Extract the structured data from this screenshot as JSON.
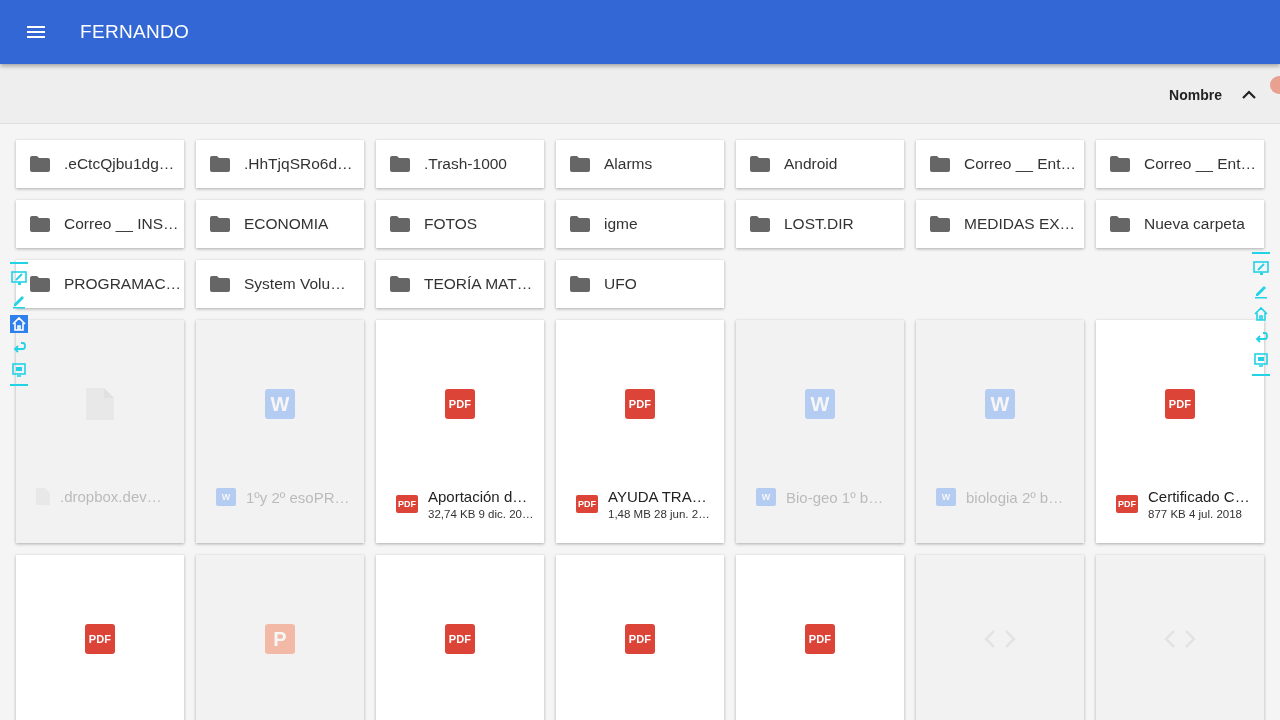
{
  "app_bar": {
    "title": "FERNANDO"
  },
  "sort_bar": {
    "label": "Nombre",
    "ascending": true
  },
  "folders": [
    {
      "name": ".eCtcQjbu1dg…"
    },
    {
      "name": ".HhTjqSRo6d…"
    },
    {
      "name": ".Trash-1000"
    },
    {
      "name": "Alarms"
    },
    {
      "name": "Android"
    },
    {
      "name": "Correo __ Ent…"
    },
    {
      "name": "Correo __ Ent…"
    },
    {
      "name": "Correo __ INS…"
    },
    {
      "name": "ECONOMIA"
    },
    {
      "name": "FOTOS"
    },
    {
      "name": "igme"
    },
    {
      "name": "LOST.DIR"
    },
    {
      "name": "MEDIDAS EX…"
    },
    {
      "name": "Nueva carpeta"
    },
    {
      "name": "PROGRAMAC…"
    },
    {
      "name": "System Volu…"
    },
    {
      "name": "TEORÍA MAT…"
    },
    {
      "name": "UFO"
    }
  ],
  "files": [
    {
      "kind": "generic",
      "dimmed": true,
      "name": ".dropbox.dev…"
    },
    {
      "kind": "word",
      "dimmed": true,
      "badge": "W",
      "small_badge": "W",
      "name": "1ºy 2º esoPR…"
    },
    {
      "kind": "pdf",
      "dimmed": false,
      "badge": "PDF",
      "small_badge": "PDF",
      "name": "Aportación d…",
      "details": "32,74 KB 9 dic. 20…"
    },
    {
      "kind": "pdf",
      "dimmed": false,
      "badge": "PDF",
      "small_badge": "PDF",
      "name": "AYUDA TRA…",
      "details": "1,48 MB 28 jun. 2…"
    },
    {
      "kind": "word",
      "dimmed": true,
      "badge": "W",
      "small_badge": "W",
      "name": "Bio-geo 1º b…"
    },
    {
      "kind": "word",
      "dimmed": true,
      "badge": "W",
      "small_badge": "W",
      "name": "biologia 2º b…"
    },
    {
      "kind": "pdf",
      "dimmed": false,
      "badge": "PDF",
      "small_badge": "PDF",
      "name": "Certificado C…",
      "details": "877 KB 4 jul. 2018"
    },
    {
      "kind": "pdf",
      "dimmed": false,
      "badge": "PDF"
    },
    {
      "kind": "ppt",
      "dimmed": true,
      "badge": "P"
    },
    {
      "kind": "pdf",
      "dimmed": false,
      "badge": "PDF"
    },
    {
      "kind": "pdf",
      "dimmed": false,
      "badge": "PDF"
    },
    {
      "kind": "pdf",
      "dimmed": false,
      "badge": "PDF"
    },
    {
      "kind": "code",
      "dimmed": true
    },
    {
      "kind": "code",
      "dimmed": true
    }
  ],
  "overlay_toolbars": [
    {
      "kind": "left",
      "tools": [
        {
          "kind": "annotate",
          "selected": false
        },
        {
          "kind": "pencil",
          "selected": false
        },
        {
          "kind": "home",
          "selected": true
        },
        {
          "kind": "back",
          "selected": false
        },
        {
          "kind": "screen",
          "selected": false
        }
      ]
    },
    {
      "kind": "right",
      "tools": [
        {
          "kind": "annotate",
          "selected": false
        },
        {
          "kind": "pencil",
          "selected": false
        },
        {
          "kind": "home",
          "selected": false
        },
        {
          "kind": "back",
          "selected": false
        },
        {
          "kind": "screen",
          "selected": false
        }
      ]
    }
  ]
}
